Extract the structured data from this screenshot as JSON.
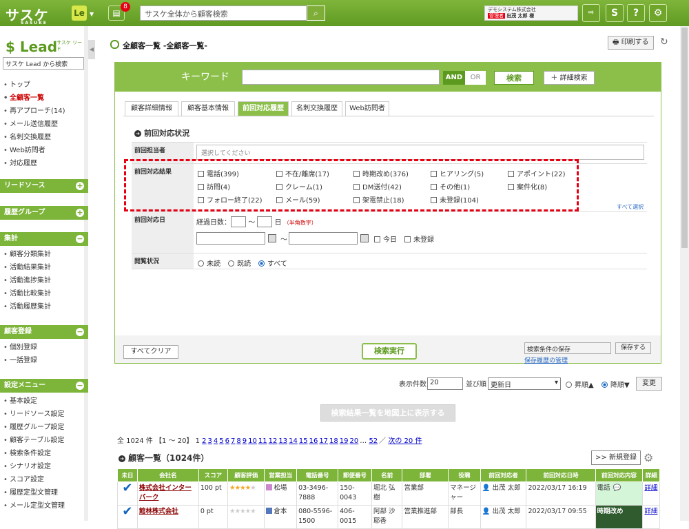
{
  "app": {
    "logo": "サスケ",
    "logo_sub": "SASUKE",
    "le_label": "Le",
    "msg_count": "8",
    "search_placeholder": "サスケ全体から顧客検索",
    "company": "デモシステム株式会社",
    "role": "管理者",
    "user": "出茂 太郎 様"
  },
  "topicons": [
    "logout-icon",
    "s-icon",
    "help-icon",
    "gear-icon"
  ],
  "sidebar": {
    "logo": "Lead",
    "logo_sub": "サスケ リード",
    "search_placeholder": "サスケ Lead から検索",
    "items": [
      {
        "label": "トップ",
        "plus": false,
        "active": false
      },
      {
        "label": "全顧客一覧",
        "plus": false,
        "active": true
      },
      {
        "label": "再アプローチ(14)",
        "plus": false,
        "active": false
      },
      {
        "label": "メール送信履歴",
        "plus": false,
        "active": false
      },
      {
        "label": "名刺交換履歴",
        "plus": true,
        "active": false
      },
      {
        "label": "Web訪問者",
        "plus": true,
        "active": false
      },
      {
        "label": "対応履歴",
        "plus": true,
        "active": false
      }
    ],
    "sections": [
      {
        "label": "リードソース",
        "icon": "+"
      },
      {
        "label": "履歴グループ",
        "icon": "+"
      },
      {
        "label": "集計",
        "icon": "−"
      },
      {
        "label": "顧客登録",
        "icon": "−"
      },
      {
        "label": "設定メニュー",
        "icon": "−"
      }
    ],
    "agg_items": [
      "顧客分類集計",
      "活動結果集計",
      "活動進捗集計",
      "活動比較集計",
      "活動履歴集計"
    ],
    "reg_items": [
      "個別登録",
      "一括登録"
    ],
    "setting_items": [
      "基本設定",
      "リードソース設定",
      "履歴グループ設定",
      "顧客テーブル設定",
      "検索条件設定",
      "シナリオ設定",
      "スコア設定",
      "履歴定型文管理",
      "メール定型文管理"
    ]
  },
  "header": {
    "title": "全顧客一覧 -全顧客一覧-",
    "print": "印刷する"
  },
  "search": {
    "keyword_label": "キーワード",
    "and": "AND",
    "or": "OR",
    "search_btn": "検索",
    "detail_btn": "＋ 詳細検索",
    "tabs": [
      "顧客詳細情報",
      "顧客基本情報",
      "前回対応履歴",
      "名刺交換履歴",
      "Web訪問者"
    ],
    "section_title": "前回対応状況",
    "assignee_label": "前回担当者",
    "assignee_placeholder": "選択してください",
    "result_label": "前回対応結果",
    "results": [
      "電話(399)",
      "不在/離席(17)",
      "時期改め(376)",
      "ヒアリング(5)",
      "アポイント(22)",
      "訪問(4)",
      "クレーム(1)",
      "DM送付(42)",
      "その他(1)",
      "案件化(8)",
      "フォロー終了(22)",
      "メール(59)",
      "架電禁止(18)",
      "未登録(104)"
    ],
    "select_all": "すべて選択",
    "date_label": "前回対応日",
    "elapsed_label": "経過日数：",
    "tilde": "〜",
    "day_unit": "日",
    "half_width": "（半角数字）",
    "today": "今日",
    "unregistered": "未登録",
    "view_label": "閲覧状況",
    "view_options": [
      "未読",
      "既読",
      "すべて"
    ],
    "clear": "すべてクリア",
    "execute": "検索実行",
    "save_placeholder": "検索条件の保存",
    "save_btn": "保存する",
    "save_history": "保存履歴の管理"
  },
  "display": {
    "count_label": "表示件数",
    "count": "20",
    "sort_label": "並び順",
    "sort": "更新日",
    "asc": "昇順▲",
    "desc": "降順▼",
    "change": "変更"
  },
  "map_btn": "検索結果一覧を地図上に表示する",
  "paging": {
    "prefix": "全 1024 件 【1 〜 20】 1",
    "pages": [
      "2",
      "3",
      "4",
      "5",
      "6",
      "7",
      "8",
      "9",
      "10",
      "11",
      "12",
      "13",
      "14",
      "15",
      "16",
      "17",
      "18",
      "19",
      "20"
    ],
    "ellipsis": "…",
    "last": "52",
    "next": "次の 20 件"
  },
  "list": {
    "title": "顧客一覧（1024件）",
    "new": ">> 新規登録",
    "columns": [
      "未日",
      "会社名",
      "スコア",
      "顧客評価",
      "営業担当",
      "電話番号",
      "郵便番号",
      "名前",
      "部署",
      "役職",
      "前回対応者",
      "前回対応日時",
      "前回対応内容",
      "詳細"
    ],
    "rows": [
      {
        "company": "株式会社インターパーク",
        "score": "100 pt",
        "stars": 4,
        "sales": "松場",
        "sales_color": "#cc88cc",
        "phone": "03-3496-7888",
        "zip": "150-0043",
        "name": "堀北 弘樹",
        "dept": "営業部",
        "title": "マネージャー",
        "prev": "出茂 太郎",
        "date": "2022/03/17 16:19",
        "content": "電話",
        "detail": "詳細"
      },
      {
        "company": "館林株式会社",
        "score": "0 pt",
        "stars": 0,
        "sales": "倉本",
        "sales_color": "#5577bb",
        "phone": "080-5596-1500",
        "zip": "406-0015",
        "name": "阿部 沙耶香",
        "dept": "営業推進部",
        "title": "部長",
        "prev": "出茂 太郎",
        "date": "2022/03/17 09:55",
        "content": "時期改め",
        "detail": "詳細"
      }
    ]
  }
}
